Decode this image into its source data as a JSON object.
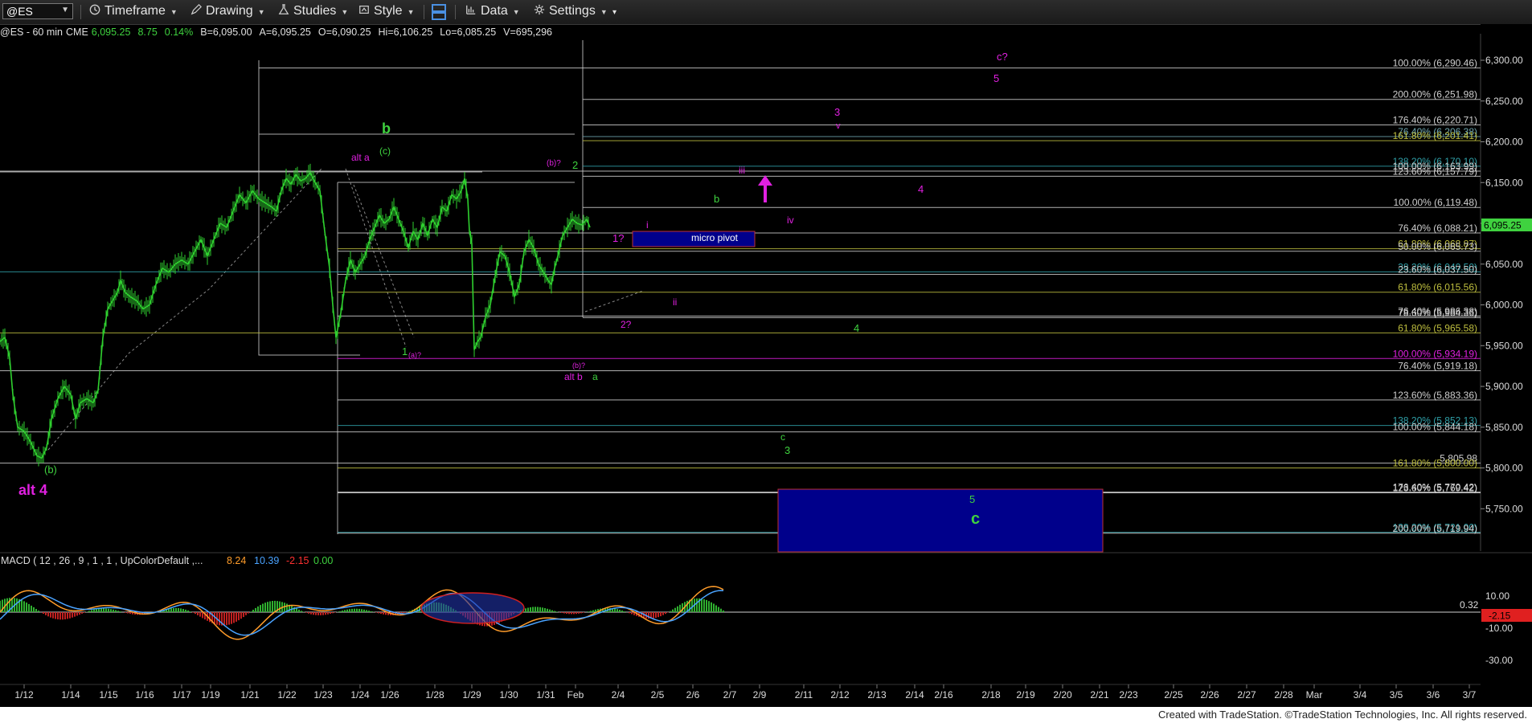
{
  "toolbar": {
    "symbol": "@ES",
    "timeframe": "Timeframe",
    "drawing": "Drawing",
    "studies": "Studies",
    "style": "Style",
    "data": "Data",
    "settings": "Settings"
  },
  "status": {
    "name": "@ES - 60 min",
    "exchange": "CME",
    "last": "6,095.25",
    "change": "8.75",
    "pct": "0.14%",
    "bid": "B=6,095.00",
    "ask": "A=6,095.25",
    "open": "O=6,090.25",
    "high": "Hi=6,106.25",
    "low": "Lo=6,085.25",
    "volume": "V=695,296"
  },
  "chart_data": {
    "type": "line",
    "series_type": "ohlc-bars",
    "price_axis": {
      "range": [
        5670,
        6330
      ],
      "ticks": [
        5750,
        5800,
        5850,
        5900,
        5950,
        6000,
        6050,
        6100,
        6150,
        6200,
        6250,
        6300
      ],
      "tick_labels": [
        "5,750.00",
        "5,800.00",
        "5,850.00",
        "5,900.00",
        "5,950.00",
        "6,000.00",
        "6,050.00",
        "6,100.00",
        "6,150.00",
        "6,200.00",
        "6,250.00",
        "6,300.00"
      ],
      "last_price_label": "6,095.25"
    },
    "date_axis": [
      "1/12",
      "1/14",
      "1/15",
      "1/16",
      "1/17",
      "1/19",
      "1/21",
      "1/22",
      "1/23",
      "1/24",
      "1/26",
      "1/28",
      "1/29",
      "1/30",
      "1/31",
      "Feb",
      "2/4",
      "2/5",
      "2/6",
      "2/7",
      "2/9",
      "2/11",
      "2/12",
      "2/13",
      "2/14",
      "2/16",
      "2/18",
      "2/19",
      "2/20",
      "2/21",
      "2/23",
      "2/25",
      "2/26",
      "2/27",
      "2/28",
      "Mar",
      "3/4",
      "3/5",
      "3/6",
      "3/7"
    ],
    "price_path": [
      [
        0,
        5955
      ],
      [
        6,
        5960
      ],
      [
        12,
        5935
      ],
      [
        16,
        5890
      ],
      [
        22,
        5850
      ],
      [
        30,
        5845
      ],
      [
        38,
        5832
      ],
      [
        46,
        5815
      ],
      [
        52,
        5812
      ],
      [
        58,
        5825
      ],
      [
        64,
        5860
      ],
      [
        72,
        5885
      ],
      [
        80,
        5900
      ],
      [
        88,
        5890
      ],
      [
        94,
        5860
      ],
      [
        100,
        5880
      ],
      [
        108,
        5885
      ],
      [
        116,
        5880
      ],
      [
        122,
        5895
      ],
      [
        128,
        5960
      ],
      [
        134,
        5995
      ],
      [
        140,
        6005
      ],
      [
        146,
        6015
      ],
      [
        150,
        6030
      ],
      [
        156,
        6015
      ],
      [
        162,
        6010
      ],
      [
        170,
        6005
      ],
      [
        178,
        5995
      ],
      [
        186,
        6000
      ],
      [
        194,
        6025
      ],
      [
        202,
        6045
      ],
      [
        210,
        6040
      ],
      [
        218,
        6050
      ],
      [
        226,
        6055
      ],
      [
        234,
        6050
      ],
      [
        242,
        6065
      ],
      [
        250,
        6080
      ],
      [
        258,
        6060
      ],
      [
        266,
        6080
      ],
      [
        274,
        6100
      ],
      [
        282,
        6095
      ],
      [
        290,
        6115
      ],
      [
        298,
        6135
      ],
      [
        306,
        6125
      ],
      [
        314,
        6140
      ],
      [
        322,
        6130
      ],
      [
        330,
        6125
      ],
      [
        338,
        6120
      ],
      [
        344,
        6115
      ],
      [
        350,
        6140
      ],
      [
        356,
        6155
      ],
      [
        362,
        6148
      ],
      [
        368,
        6160
      ],
      [
        374,
        6152
      ],
      [
        380,
        6155
      ],
      [
        386,
        6162
      ],
      [
        392,
        6150
      ],
      [
        398,
        6140
      ],
      [
        404,
        6090
      ],
      [
        410,
        6045
      ],
      [
        414,
        6000
      ],
      [
        418,
        5960
      ],
      [
        424,
        5990
      ],
      [
        430,
        6030
      ],
      [
        436,
        6055
      ],
      [
        442,
        6040
      ],
      [
        448,
        6050
      ],
      [
        454,
        6060
      ],
      [
        460,
        6080
      ],
      [
        466,
        6095
      ],
      [
        472,
        6110
      ],
      [
        478,
        6100
      ],
      [
        484,
        6105
      ],
      [
        490,
        6120
      ],
      [
        496,
        6105
      ],
      [
        502,
        6090
      ],
      [
        508,
        6070
      ],
      [
        514,
        6090
      ],
      [
        520,
        6080
      ],
      [
        526,
        6100
      ],
      [
        532,
        6085
      ],
      [
        538,
        6105
      ],
      [
        544,
        6095
      ],
      [
        550,
        6120
      ],
      [
        556,
        6115
      ],
      [
        562,
        6135
      ],
      [
        568,
        6130
      ],
      [
        574,
        6140
      ],
      [
        578,
        6155
      ],
      [
        582,
        6130
      ],
      [
        584,
        6090
      ],
      [
        587,
        6075
      ],
      [
        590,
        5945
      ],
      [
        594,
        5955
      ],
      [
        598,
        5960
      ],
      [
        604,
        5985
      ],
      [
        610,
        6000
      ],
      [
        616,
        6035
      ],
      [
        622,
        6065
      ],
      [
        628,
        6060
      ],
      [
        634,
        6040
      ],
      [
        640,
        6010
      ],
      [
        646,
        6025
      ],
      [
        652,
        6065
      ],
      [
        658,
        6080
      ],
      [
        664,
        6070
      ],
      [
        670,
        6050
      ],
      [
        676,
        6040
      ],
      [
        682,
        6030
      ],
      [
        686,
        6025
      ],
      [
        690,
        6045
      ],
      [
        694,
        6060
      ],
      [
        700,
        6085
      ],
      [
        706,
        6095
      ],
      [
        712,
        6105
      ],
      [
        718,
        6100
      ],
      [
        724,
        6098
      ],
      [
        730,
        6105
      ],
      [
        734,
        6095
      ]
    ],
    "fib_levels": [
      {
        "label": "100.00% (6,290.46)",
        "value": 6290.46,
        "color": "#cfcfcf"
      },
      {
        "label": "200.00% (6,251.98)",
        "value": 6251.98,
        "color": "#cfcfcf"
      },
      {
        "label": "176.40% (6,220.71)",
        "value": 6220.71,
        "color": "#cfcfcf"
      },
      {
        "label": "76.40% (6,206.38)",
        "value": 6206.38,
        "color": "#6fa7b0"
      },
      {
        "label": "161.80% (6,201.41)",
        "value": 6201.41,
        "color": "#bfbf3f"
      },
      {
        "label": "138.20% (6,170.10)",
        "value": 6170.1,
        "color": "#2fa0a8"
      },
      {
        "label": "100.00% (6,163.99)",
        "value": 6163.99,
        "color": "#cfcfcf"
      },
      {
        "label": "123.60% (6,157.79)",
        "value": 6157.79,
        "color": "#cfcfcf"
      },
      {
        "label": "100.00% (6,119.48)",
        "value": 6119.48,
        "color": "#cfcfcf"
      },
      {
        "label": "76.40% (6,088.21)",
        "value": 6088.21,
        "color": "#cfcfcf"
      },
      {
        "label": "61.80% (6,068.87)",
        "value": 6068.87,
        "color": "#bfbf3f"
      },
      {
        "label": "50.00% (6,065.73)",
        "value": 6065.73,
        "color": "#cfcfcf"
      },
      {
        "label": "38.20% (6,040.50)",
        "value": 6040.5,
        "color": "#2fa0a8"
      },
      {
        "label": "23.60% (6,037.50)",
        "value": 6037.5,
        "color": "#cfcfcf"
      },
      {
        "label": "61.80% (6,015.56)",
        "value": 6015.56,
        "color": "#bfbf3f"
      },
      {
        "label": "76.40% (5,986.38)",
        "value": 5986.38,
        "color": "#cfcfcf"
      },
      {
        "label": "78.60% (5,984.36)",
        "value": 5984.36,
        "color": "#cfcfcf"
      },
      {
        "label": "61.80% (5,965.58)",
        "value": 5965.58,
        "color": "#bfbf3f"
      },
      {
        "label": "100.00% (5,934.19)",
        "value": 5934.19,
        "color": "#e020e0"
      },
      {
        "label": "76.40% (5,919.18)",
        "value": 5919.18,
        "color": "#cfcfcf"
      },
      {
        "label": "123.60% (5,883.36)",
        "value": 5883.36,
        "color": "#cfcfcf"
      },
      {
        "label": "138.20% (5,852.13)",
        "value": 5852.13,
        "color": "#2fa0a8"
      },
      {
        "label": "100.00% (5,844.18)",
        "value": 5844.18,
        "color": "#cfcfcf"
      },
      {
        "label": "5,805.98",
        "value": 5805.98,
        "color": "#cfcfcf"
      },
      {
        "label": "161.80% (5,800.00)",
        "value": 5800.0,
        "color": "#bfbf3f"
      },
      {
        "label": "176.40% (5,770.42)",
        "value": 5770.42,
        "color": "#cfcfcf"
      },
      {
        "label": "123.60% (5,769.42)",
        "value": 5769.42,
        "color": "#cfcfcf"
      },
      {
        "label": "138.20% (5,721.00)",
        "value": 5721.0,
        "color": "#2fa0a8"
      },
      {
        "label": "200.00% (5,719.94)",
        "value": 5719.94,
        "color": "#cfcfcf"
      }
    ],
    "wave_labels": [
      {
        "text": "b",
        "color": "#3fd23f"
      },
      {
        "text": "(c)",
        "color": "#3fd23f"
      },
      {
        "text": "alt a",
        "color": "#e020e0"
      },
      {
        "text": "(b)?",
        "color": "#e020e0"
      },
      {
        "text": "2",
        "color": "#3fd23f"
      },
      {
        "text": "iii",
        "color": "#e020e0"
      },
      {
        "text": "3",
        "color": "#e020e0"
      },
      {
        "text": "v",
        "color": "#e020e0"
      },
      {
        "text": "c?",
        "color": "#e020e0"
      },
      {
        "text": "5",
        "color": "#e020e0"
      },
      {
        "text": "4",
        "color": "#e020e0"
      },
      {
        "text": "b",
        "color": "#3fd23f"
      },
      {
        "text": "i",
        "color": "#e020e0"
      },
      {
        "text": "iv",
        "color": "#e020e0"
      },
      {
        "text": "1?",
        "color": "#e020e0"
      },
      {
        "text": "micro pivot",
        "color": "#ffffff"
      },
      {
        "text": "ii",
        "color": "#e020e0"
      },
      {
        "text": "2?",
        "color": "#e020e0"
      },
      {
        "text": "4",
        "color": "#3fd23f"
      },
      {
        "text": "1",
        "color": "#3fd23f"
      },
      {
        "text": "(a)?",
        "color": "#e020e0"
      },
      {
        "text": "(b)?",
        "color": "#e020e0"
      },
      {
        "text": "alt b",
        "color": "#e020e0"
      },
      {
        "text": "a",
        "color": "#3fd23f"
      },
      {
        "text": "c",
        "color": "#3fd23f"
      },
      {
        "text": "3",
        "color": "#3fd23f"
      },
      {
        "text": "(b)",
        "color": "#3fd23f"
      },
      {
        "text": "alt 4",
        "color": "#e020e0"
      },
      {
        "text": "5",
        "color": "#3fd23f"
      },
      {
        "text": "c",
        "color": "#3fd23f"
      }
    ],
    "macd": {
      "label": "MACD ( 12 , 26 , 9 , 1 , 1 , UpColorDefault ,...",
      "macd": "8.24",
      "signal": "10.39",
      "hist": "-2.15",
      "zero": "0.00",
      "axis_ticks": [
        "10.00",
        "-10.00",
        "-30.00"
      ],
      "zero_line_label": "0.32",
      "last_label": "-2.15"
    }
  },
  "footer": "Created with TradeStation. ©TradeStation Technologies, Inc. All rights reserved."
}
